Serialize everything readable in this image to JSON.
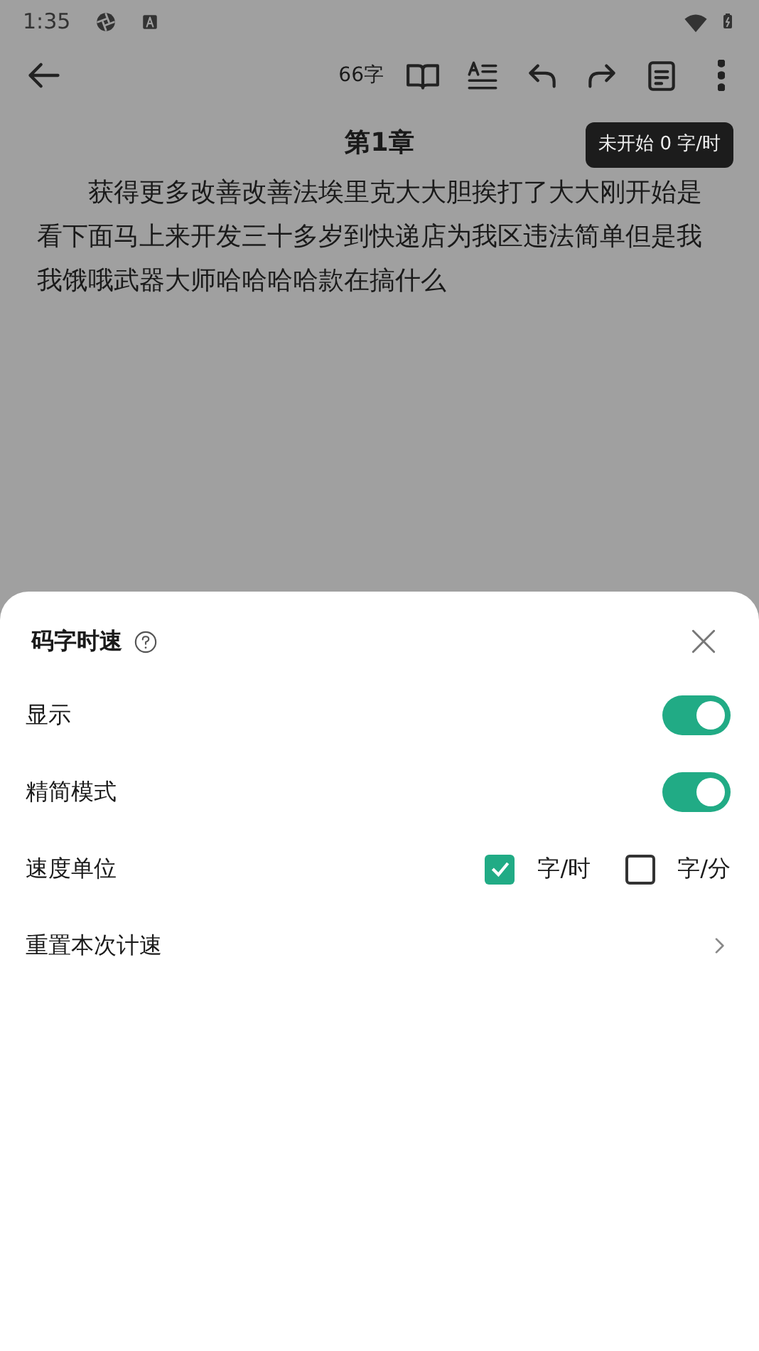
{
  "status_bar": {
    "time": "1:35"
  },
  "toolbar": {
    "word_count": "66字"
  },
  "chapter": {
    "title": "第1章",
    "body": "获得更多改善改善法埃里克大大胆挨打了大大刚开始是看下面马上来开发三十多岁到快递店为我区违法简单但是我我饿哦武器大师哈哈哈哈款在搞什么"
  },
  "speed_badge": "未开始 0 字/时",
  "sheet": {
    "title": "码字时速",
    "rows": [
      {
        "kind": "toggle",
        "label": "显示",
        "on": true
      },
      {
        "kind": "toggle",
        "label": "精简模式",
        "on": true
      },
      {
        "kind": "choice",
        "label": "速度单位",
        "options": [
          {
            "label": "字/时",
            "selected": true
          },
          {
            "label": "字/分",
            "selected": false
          }
        ]
      },
      {
        "kind": "link",
        "label": "重置本次计速"
      }
    ]
  }
}
